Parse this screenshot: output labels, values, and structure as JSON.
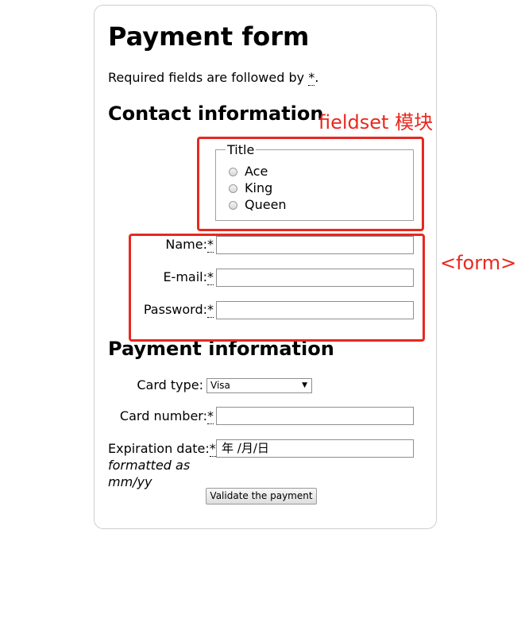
{
  "page": {
    "title": "Payment form",
    "required_note_prefix": "Required fields are followed by ",
    "required_marker": "*",
    "required_note_suffix": "."
  },
  "contact": {
    "heading": "Contact information",
    "fieldset": {
      "legend": "Title",
      "options": [
        "Ace",
        "King",
        "Queen"
      ]
    },
    "fields": {
      "name_label": "Name:",
      "email_label": "E-mail:",
      "password_label": "Password:"
    }
  },
  "payment": {
    "heading": "Payment information",
    "card_type_label": "Card type:",
    "card_type_selected": "Visa",
    "card_number_label": "Card number:",
    "expiration_label": "Expiration date:",
    "expiration_value": "年 /月/日",
    "expiration_hint_line1": "formatted as",
    "expiration_hint_line2": "mm/yy",
    "submit_label": "Validate the payment"
  },
  "annotations": {
    "fieldset_note": "fieldset 模块",
    "form_note": "<form>"
  },
  "colors": {
    "annotation": "#e8281f",
    "card_border": "#cfcfcf"
  }
}
